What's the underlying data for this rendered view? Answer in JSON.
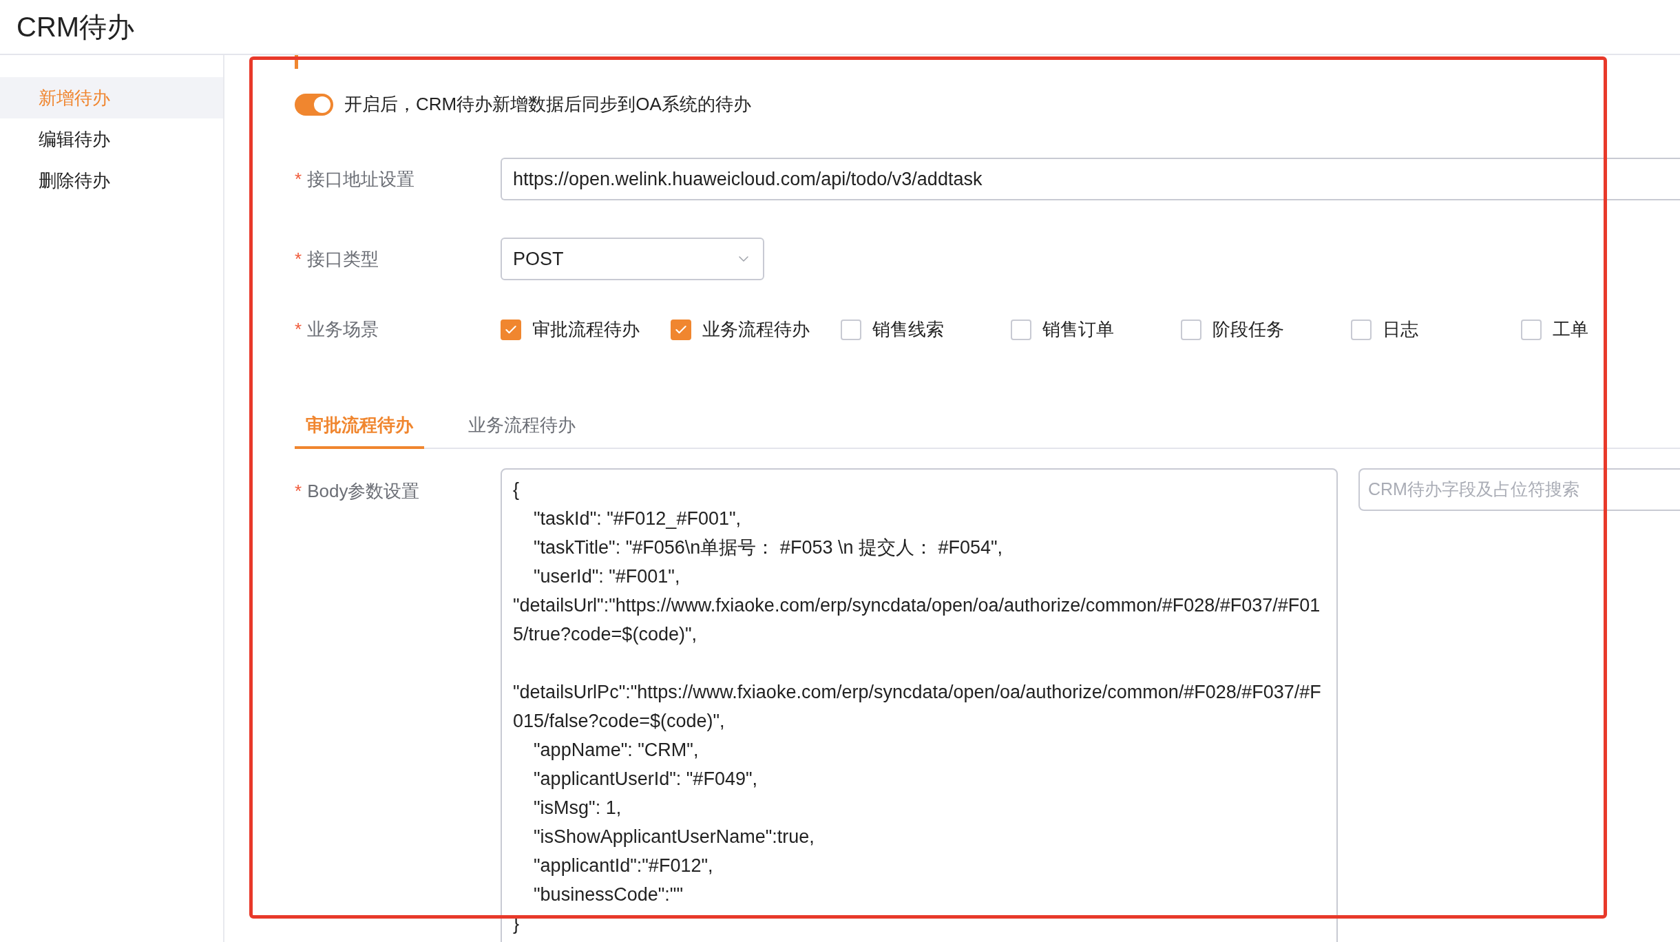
{
  "header": {
    "title": "CRM待办"
  },
  "sidebar": {
    "items": [
      {
        "label": "新增待办",
        "selected": true
      },
      {
        "label": "编辑待办",
        "selected": false
      },
      {
        "label": "删除待办",
        "selected": false
      }
    ]
  },
  "sync_toggle": {
    "on": true,
    "label": "开启后，CRM待办新增数据后同步到OA系统的待办"
  },
  "form": {
    "url": {
      "label": "接口地址设置",
      "required_mark": "*",
      "value": "https://open.welink.huaweicloud.com/api/todo/v3/addtask"
    },
    "method": {
      "label": "接口类型",
      "required_mark": "*",
      "value": "POST"
    },
    "scenes": {
      "label": "业务场景",
      "required_mark": "*",
      "options": [
        {
          "label": "审批流程待办",
          "checked": true
        },
        {
          "label": "业务流程待办",
          "checked": true
        },
        {
          "label": "销售线索",
          "checked": false
        },
        {
          "label": "销售订单",
          "checked": false
        },
        {
          "label": "阶段任务",
          "checked": false
        },
        {
          "label": "日志",
          "checked": false
        },
        {
          "label": "工单",
          "checked": false
        }
      ]
    }
  },
  "tabs": [
    {
      "label": "审批流程待办",
      "selected": true
    },
    {
      "label": "业务流程待办",
      "selected": false
    }
  ],
  "body": {
    "label": "Body参数设置",
    "required_mark": "*",
    "value": "{\n    \"taskId\": \"#F012_#F001\",\n    \"taskTitle\": \"#F056\\n单据号： #F053 \\n 提交人： #F054\",\n    \"userId\": \"#F001\",\n\"detailsUrl\":\"https://www.fxiaoke.com/erp/syncdata/open/oa/authorize/common/#F028/#F037/#F015/true?code=$(code)\",\n\n\"detailsUrlPc\":\"https://www.fxiaoke.com/erp/syncdata/open/oa/authorize/common/#F028/#F037/#F015/false?code=$(code)\",\n    \"appName\": \"CRM\",\n    \"applicantUserId\": \"#F049\",\n    \"isMsg\": 1,\n    \"isShowApplicantUserName\":true,\n    \"applicantId\":\"#F012\",\n    \"businessCode\":\"\"\n}",
    "search_placeholder": "CRM待办字段及占位符搜索"
  }
}
